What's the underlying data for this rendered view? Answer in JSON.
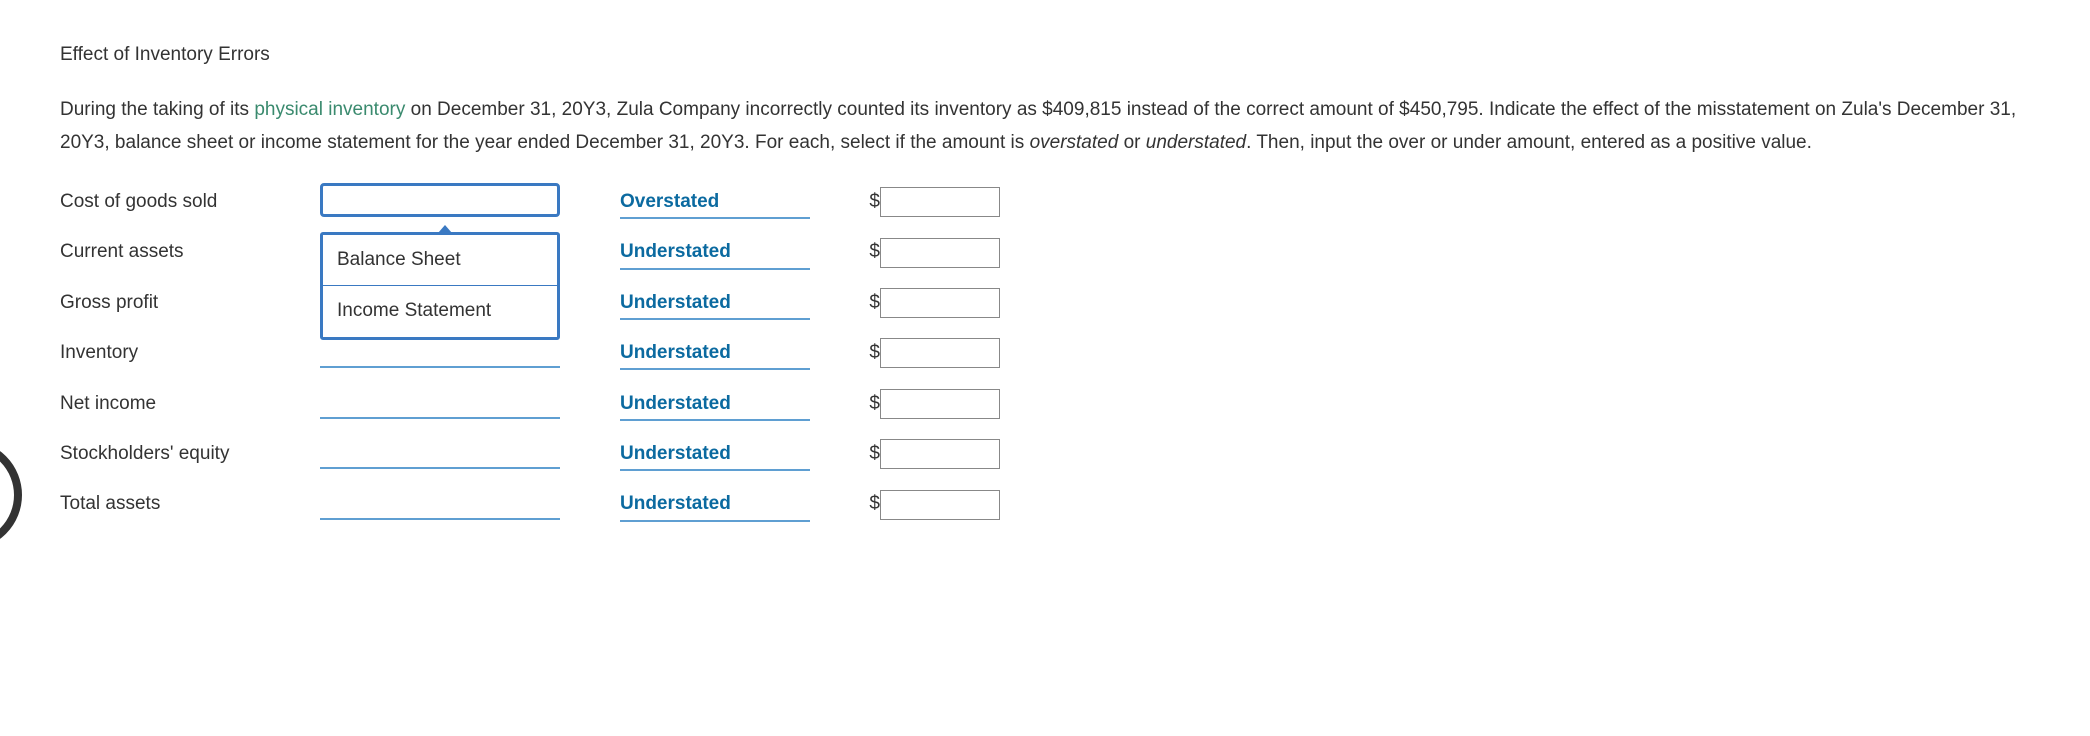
{
  "heading": "Effect of Inventory Errors",
  "intro": {
    "part1": "During the taking of its ",
    "link_term": "physical inventory",
    "part2": " on December 31, 20Y3, Zula Company incorrectly counted its inventory as $409,815 instead of the correct amount of $450,795. Indicate the effect of the misstatement on Zula's December 31, 20Y3, balance sheet or income statement for the year ended December 31, 20Y3. For each, select if the amount is ",
    "italic1": "overstated",
    "part3": " or ",
    "italic2": "understated",
    "part4": ". Then, input the over or under amount, entered as a positive value."
  },
  "rows": [
    {
      "label": "Cost of goods sold",
      "statement_selected": "",
      "effect": "Overstated",
      "amount": ""
    },
    {
      "label": "Current assets",
      "statement_selected": "",
      "effect": "Understated",
      "amount": ""
    },
    {
      "label": "Gross profit",
      "statement_selected": "",
      "effect": "Understated",
      "amount": ""
    },
    {
      "label": "Inventory",
      "statement_selected": "",
      "effect": "Understated",
      "amount": ""
    },
    {
      "label": "Net income",
      "statement_selected": "",
      "effect": "Understated",
      "amount": ""
    },
    {
      "label": "Stockholders' equity",
      "statement_selected": "",
      "effect": "Understated",
      "amount": ""
    },
    {
      "label": "Total assets",
      "statement_selected": "",
      "effect": "Understated",
      "amount": ""
    }
  ],
  "dropdown": {
    "open_on_row_index": 0,
    "options": [
      "Balance Sheet",
      "Income Statement"
    ]
  },
  "currency_symbol": "$"
}
